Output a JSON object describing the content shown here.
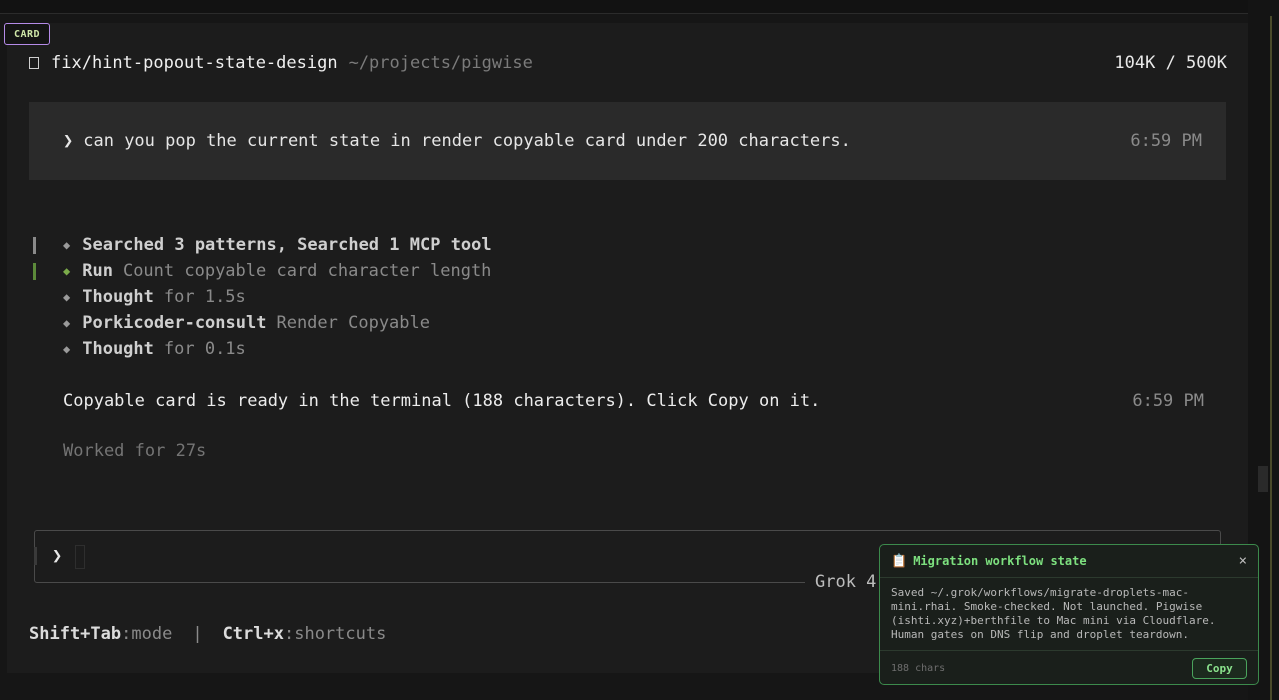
{
  "card_tag": "CARD",
  "header": {
    "branch": "fix/hint-popout-state-design",
    "path": "~/projects/pigwise",
    "tokens": "104K / 500K"
  },
  "prompt": {
    "chevron": "❯",
    "text": "can you pop the current state in render copyable card under 200 characters.",
    "time": "6:59 PM"
  },
  "tools": [
    {
      "head": "Searched 3 patterns, Searched 1 MCP tool",
      "rest": "",
      "bar_color": "#8a8a8a",
      "diamond_color": "#9a9a9a"
    },
    {
      "head": "Run",
      "rest": "Count copyable card character length",
      "bar_color": "#5c8a3a",
      "diamond_color": "#7bab4a"
    },
    {
      "head": "Thought",
      "rest": "for 1.5s",
      "bar_color": "",
      "diamond_color": "#9a9a9a"
    },
    {
      "head": "Porkicoder-consult",
      "rest": "Render Copyable",
      "bar_color": "",
      "diamond_color": "#9a9a9a"
    },
    {
      "head": "Thought",
      "rest": "for 0.1s",
      "bar_color": "",
      "diamond_color": "#9a9a9a"
    }
  ],
  "answer": {
    "text": "Copyable card is ready in the terminal (188 characters). Click Copy on it.",
    "time": "6:59 PM"
  },
  "worked": "Worked for 27s",
  "input": {
    "chevron": "❯",
    "model": "Grok 4"
  },
  "shortcuts": {
    "key1": "Shift+Tab",
    "label1": ":mode",
    "separator": "|",
    "key2": "Ctrl+x",
    "label2": ":shortcuts"
  },
  "popout": {
    "icon": "📋",
    "title": "Migration workflow state",
    "close": "×",
    "body": "Saved ~/.grok/workflows/migrate-droplets-mac-mini.rhai. Smoke-checked. Not launched. Pigwise (ishti.xyz)+berthfile to Mac mini via Cloudflare. Human gates on DNS flip and droplet teardown.",
    "count": "188 chars",
    "copy_label": "Copy"
  }
}
